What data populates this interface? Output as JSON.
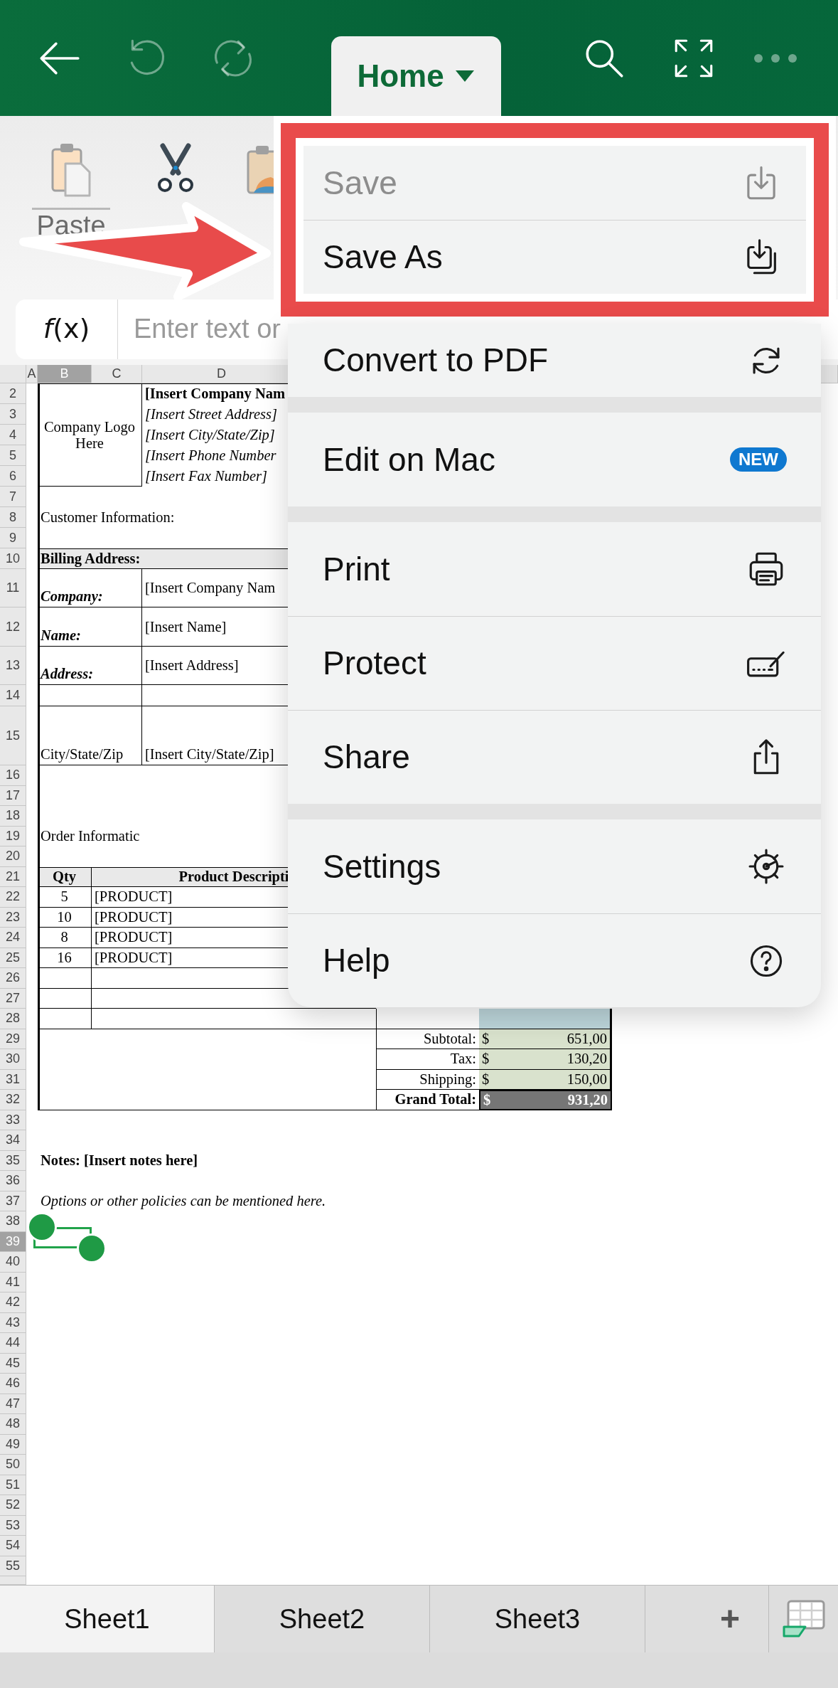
{
  "toolbar": {
    "buttons": [
      {
        "kind": "back",
        "disabled": false
      },
      {
        "kind": "undo",
        "disabled": true
      },
      {
        "kind": "redo",
        "disabled": true
      }
    ],
    "tab": "Home",
    "actions": [
      {
        "kind": "search",
        "disabled": false
      },
      {
        "kind": "expand",
        "disabled": false
      },
      {
        "kind": "more",
        "disabled": true
      }
    ]
  },
  "ribbon": {
    "commands": [
      {
        "kind": "paste",
        "label": "Paste"
      },
      {
        "kind": "cut"
      },
      {
        "kind": "format-painter"
      }
    ]
  },
  "formula_bar": {
    "function_label": "*f*(x)",
    "placeholder": "Enter text or"
  },
  "sheet": {
    "columns": [
      {
        "label": "A",
        "selected": false
      },
      {
        "label": "B",
        "selected": true
      },
      {
        "label": "C",
        "selected": false
      },
      {
        "label": "D",
        "selected": false
      }
    ],
    "rows": [
      {
        "label": "2",
        "selected": false
      },
      {
        "label": "3",
        "selected": false
      },
      {
        "label": "4",
        "selected": false
      },
      {
        "label": "5",
        "selected": false
      },
      {
        "label": "6",
        "selected": false
      },
      {
        "label": "7",
        "selected": false
      },
      {
        "label": "8",
        "selected": false
      },
      {
        "label": "9",
        "selected": false
      },
      {
        "label": "10",
        "selected": false
      },
      {
        "label": "11",
        "selected": false
      },
      {
        "label": "12",
        "selected": false
      },
      {
        "label": "13",
        "selected": false
      },
      {
        "label": "14",
        "selected": false
      },
      {
        "label": "15",
        "selected": false
      },
      {
        "label": "16",
        "selected": false
      },
      {
        "label": "17",
        "selected": false
      },
      {
        "label": "18",
        "selected": false
      },
      {
        "label": "19",
        "selected": false
      },
      {
        "label": "20",
        "selected": false
      },
      {
        "label": "21",
        "selected": false
      },
      {
        "label": "22",
        "selected": false
      },
      {
        "label": "23",
        "selected": false
      },
      {
        "label": "24",
        "selected": false
      },
      {
        "label": "25",
        "selected": false
      },
      {
        "label": "26",
        "selected": false
      },
      {
        "label": "27",
        "selected": false
      },
      {
        "label": "28",
        "selected": false
      },
      {
        "label": "29",
        "selected": false
      },
      {
        "label": "30",
        "selected": false
      },
      {
        "label": "31",
        "selected": false
      },
      {
        "label": "32",
        "selected": false
      },
      {
        "label": "33",
        "selected": false
      },
      {
        "label": "34",
        "selected": false
      },
      {
        "label": "35",
        "selected": false
      },
      {
        "label": "36",
        "selected": false
      },
      {
        "label": "37",
        "selected": false
      },
      {
        "label": "38",
        "selected": false
      },
      {
        "label": "39",
        "selected": true
      },
      {
        "label": "40",
        "selected": false
      },
      {
        "label": "41",
        "selected": false
      },
      {
        "label": "42",
        "selected": false
      },
      {
        "label": "43",
        "selected": false
      },
      {
        "label": "44",
        "selected": false
      },
      {
        "label": "45",
        "selected": false
      },
      {
        "label": "46",
        "selected": false
      },
      {
        "label": "47",
        "selected": false
      },
      {
        "label": "48",
        "selected": false
      },
      {
        "label": "49",
        "selected": false
      },
      {
        "label": "50",
        "selected": false
      },
      {
        "label": "51",
        "selected": false
      },
      {
        "label": "52",
        "selected": false
      },
      {
        "label": "53",
        "selected": false
      },
      {
        "label": "54",
        "selected": false
      },
      {
        "label": "55",
        "selected": false
      }
    ],
    "form": {
      "logo": "Company Logo Here",
      "company_lines": [
        "[Insert Company Nam",
        "[Insert Street Address]",
        "[Insert City/State/Zip]",
        "[Insert Phone Number",
        "[Insert Fax Number]"
      ],
      "customer_heading": "Customer Information:",
      "billing": {
        "title": "Billing Address:",
        "fields": [
          {
            "label": "Company:",
            "value": "[Insert Company Nam"
          },
          {
            "label": "Name:",
            "value": "[Insert Name]"
          },
          {
            "label": "Address:",
            "value": "[Insert Address]"
          },
          {
            "label": "City/State/Zip",
            "value": "[Insert City/State/Zip]"
          }
        ]
      },
      "order": {
        "title": "Order Informatic",
        "columns": [
          "Qty",
          "Product Descripti"
        ],
        "items": [
          {
            "qty": "5",
            "product": "[PRODUCT]"
          },
          {
            "qty": "10",
            "product": "[PRODUCT]"
          },
          {
            "qty": "8",
            "product": "[PRODUCT]"
          },
          {
            "qty": "16",
            "product": "[PRODUCT]"
          }
        ]
      },
      "totals": [
        {
          "label": "Subtotal:",
          "currency": "$",
          "amount": "651,00",
          "kind": "sum"
        },
        {
          "label": "Tax:",
          "currency": "$",
          "amount": "130,20",
          "kind": "sum"
        },
        {
          "label": "Shipping:",
          "currency": "$",
          "amount": "150,00",
          "kind": "sum"
        },
        {
          "label": "Grand Total:",
          "currency": "$",
          "amount": "931,20",
          "kind": "grand"
        }
      ],
      "notes": "Notes: [Insert notes here]",
      "policy": "Options or other policies can be mentioned here."
    }
  },
  "menu": {
    "sections": [
      {
        "items": [
          {
            "label": "Save",
            "kind": "save",
            "disabled": true
          },
          {
            "label": "Save As",
            "kind": "save-as",
            "disabled": false
          },
          {
            "label": "Convert to PDF",
            "kind": "convert",
            "disabled": false
          }
        ]
      },
      {
        "items": [
          {
            "label": "Edit on Mac",
            "badge": "NEW",
            "disabled": false
          }
        ]
      },
      {
        "items": [
          {
            "label": "Print",
            "kind": "print",
            "disabled": false
          },
          {
            "label": "Protect",
            "kind": "protect",
            "disabled": false
          },
          {
            "label": "Share",
            "kind": "share",
            "disabled": false
          }
        ]
      },
      {
        "items": [
          {
            "label": "Settings",
            "kind": "settings",
            "disabled": false
          },
          {
            "label": "Help",
            "kind": "help",
            "disabled": false
          }
        ]
      }
    ]
  },
  "sheet_tabs": [
    {
      "label": "Sheet1",
      "selected": true
    },
    {
      "label": "Sheet2",
      "selected": false
    },
    {
      "label": "Sheet3",
      "selected": false
    }
  ],
  "add_sheet": "+"
}
